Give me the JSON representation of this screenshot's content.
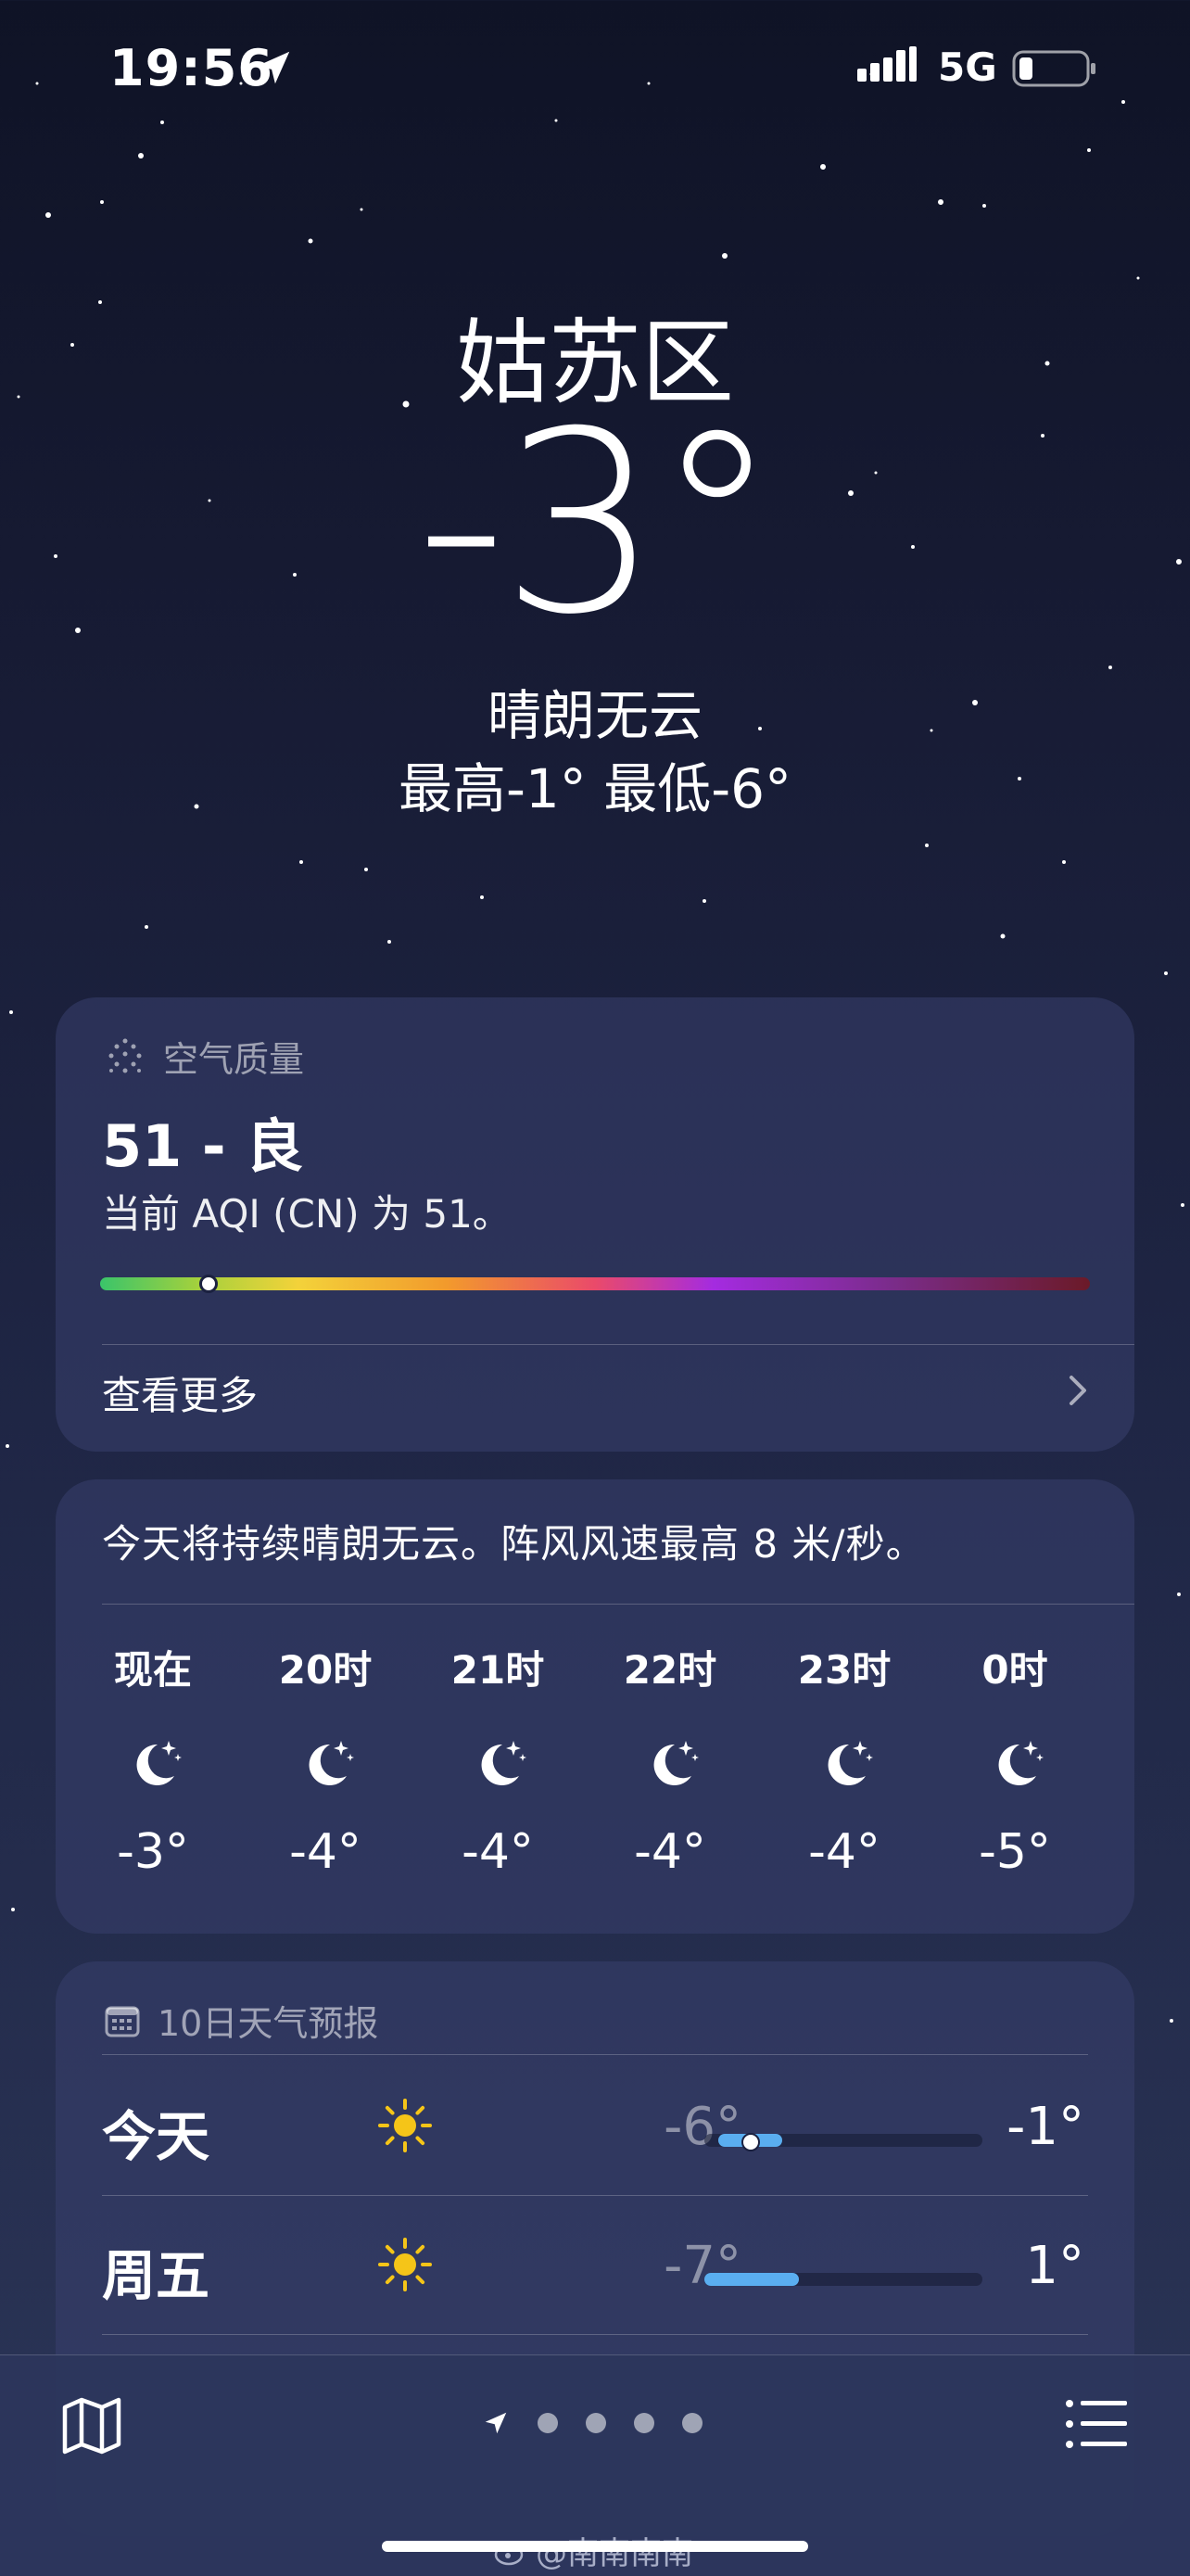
{
  "status_bar": {
    "time": "19:56",
    "network": "5G"
  },
  "hero": {
    "city": "姑苏区",
    "temperature": "-3°",
    "condition": "晴朗无云",
    "high_low": "最高-1°  最低-6°"
  },
  "air_quality": {
    "header": "空气质量",
    "value": "51 - 良",
    "description": "当前 AQI (CN) 为 51。",
    "level_fraction": 0.11,
    "see_more": "查看更多"
  },
  "hourly": {
    "summary": "今天将持续晴朗无云。阵风风速最高 8 米/秒。",
    "items": [
      {
        "label": "现在",
        "icon": "moon-stars-icon",
        "temp": "-3°"
      },
      {
        "label": "20时",
        "icon": "moon-stars-icon",
        "temp": "-4°"
      },
      {
        "label": "21时",
        "icon": "moon-stars-icon",
        "temp": "-4°"
      },
      {
        "label": "22时",
        "icon": "moon-stars-icon",
        "temp": "-4°"
      },
      {
        "label": "23时",
        "icon": "moon-stars-icon",
        "temp": "-4°"
      },
      {
        "label": "0时",
        "icon": "moon-stars-icon",
        "temp": "-5°"
      }
    ]
  },
  "daily": {
    "header": "10日天气预报",
    "days": [
      {
        "name": "今天",
        "icon": "sun-icon",
        "low": "-6°",
        "high": "-1°",
        "range_start": 0.05,
        "range_end": 0.28,
        "current": 0.16
      },
      {
        "name": "周五",
        "icon": "sun-icon",
        "low": "-7°",
        "high": "1°",
        "range_start": 0.0,
        "range_end": 0.34
      }
    ]
  },
  "bottom_bar": {
    "page_count": 4,
    "watermark": "@南南南南"
  },
  "colors": {
    "bar_fill": "#5aaef0",
    "sun": "#f5c518"
  }
}
